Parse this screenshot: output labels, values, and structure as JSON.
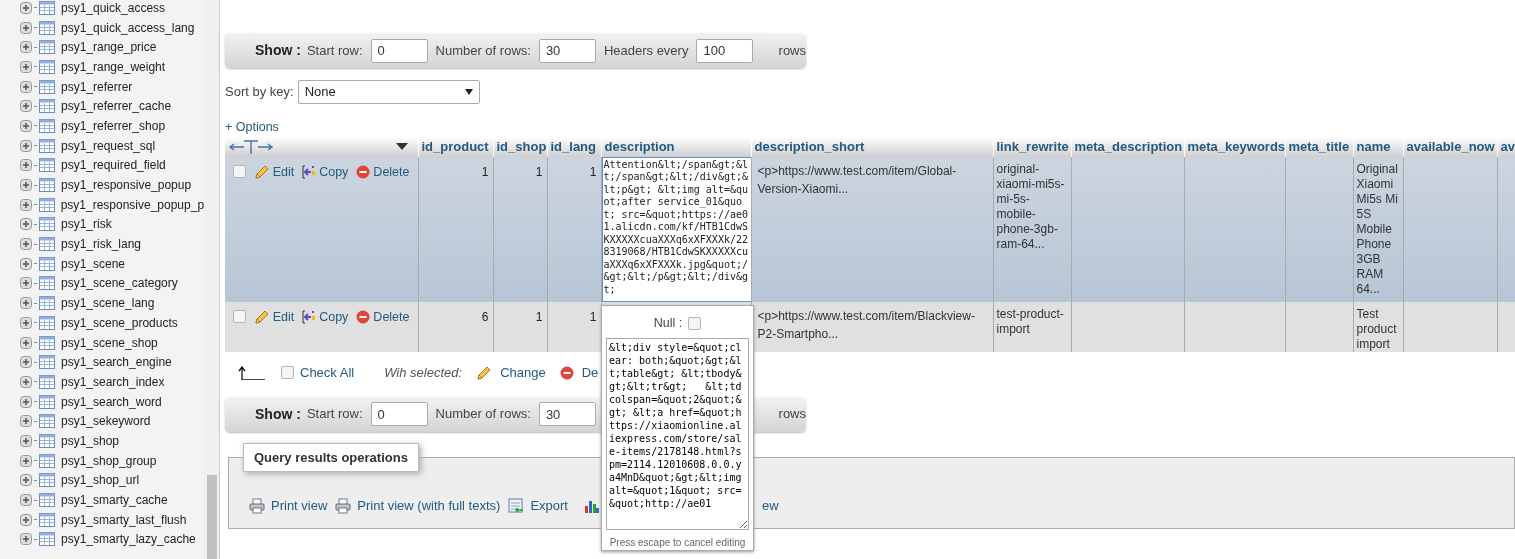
{
  "sidebar": {
    "items": [
      {
        "label": "psy1_quick_access"
      },
      {
        "label": "psy1_quick_access_lang"
      },
      {
        "label": "psy1_range_price"
      },
      {
        "label": "psy1_range_weight"
      },
      {
        "label": "psy1_referrer"
      },
      {
        "label": "psy1_referrer_cache"
      },
      {
        "label": "psy1_referrer_shop"
      },
      {
        "label": "psy1_request_sql"
      },
      {
        "label": "psy1_required_field"
      },
      {
        "label": "psy1_responsive_popup"
      },
      {
        "label": "psy1_responsive_popup_p"
      },
      {
        "label": "psy1_risk"
      },
      {
        "label": "psy1_risk_lang"
      },
      {
        "label": "psy1_scene"
      },
      {
        "label": "psy1_scene_category"
      },
      {
        "label": "psy1_scene_lang"
      },
      {
        "label": "psy1_scene_products"
      },
      {
        "label": "psy1_scene_shop"
      },
      {
        "label": "psy1_search_engine"
      },
      {
        "label": "psy1_search_index"
      },
      {
        "label": "psy1_search_word"
      },
      {
        "label": "psy1_sekeyword"
      },
      {
        "label": "psy1_shop"
      },
      {
        "label": "psy1_shop_group"
      },
      {
        "label": "psy1_shop_url"
      },
      {
        "label": "psy1_smarty_cache"
      },
      {
        "label": "psy1_smarty_last_flush"
      },
      {
        "label": "psy1_smarty_lazy_cache"
      }
    ]
  },
  "show_bars": [
    {
      "title": "Show :",
      "fields": [
        {
          "label": "Start row:",
          "value": "0"
        },
        {
          "label": "Number of rows:",
          "value": "30"
        },
        {
          "label": "Headers every",
          "value": "100"
        }
      ],
      "suffix": "rows"
    },
    {
      "title": "Show :",
      "fields": [
        {
          "label": "Start row:",
          "value": "0"
        },
        {
          "label": "Number of rows:",
          "value": "30"
        }
      ],
      "suffix": "rows"
    }
  ],
  "sort": {
    "label": "Sort by key:",
    "value": "None"
  },
  "options_link": "+ Options",
  "table": {
    "columns": [
      "id_product",
      "id_shop",
      "id_lang",
      "description",
      "description_short",
      "link_rewrite",
      "meta_description",
      "meta_keywords",
      "meta_title",
      "name",
      "available_now",
      "av"
    ],
    "rows": [
      {
        "hovered": true,
        "checked": false,
        "actions": [
          "Edit",
          "Copy",
          "Delete"
        ],
        "id_product": "1",
        "id_shop": "1",
        "id_lang": "1",
        "description": "Attention&lt;/span&gt;&lt;/span&gt;&lt;/div&gt;&lt;p&gt; &lt;img alt=&quot;after service_01&quot; src=&quot;https://ae01.alicdn.com/kf/HTB1CdwSKXXXXXcuaXXXq6xXFXXXk/228319068/HTB1CdwSKXXXXXcuaXXXq6xXFXXXk.jpg&quot;/&gt;&lt;/p&gt;&lt;/div&gt;",
        "description_short": "<p>https://www.test.com/item/Global-Version-Xiaomi...",
        "link_rewrite": "original-xiaomi-mi5s-mi-5s-mobile-phone-3gb-ram-64...",
        "name": "Original Xiaomi Mi5s Mi 5S Mobile Phone 3GB RAM 64..."
      },
      {
        "hovered": false,
        "checked": false,
        "actions": [
          "Edit",
          "Copy",
          "Delete"
        ],
        "id_product": "6",
        "id_shop": "1",
        "id_lang": "1",
        "description_short": "<p>https://www.test.com/item/Blackview-P2-Smartpho...",
        "link_rewrite": "test-product-import",
        "name": "Test product import"
      }
    ]
  },
  "editor_popup": {
    "null_label": "Null :",
    "null_checked": false,
    "value": "&lt;div style=&quot;clear: both;&quot;&gt;&lt;table&gt; &lt;tbody&gt;&lt;tr&gt;   &lt;td colspan=&quot;2&quot;&gt; &lt;a href=&quot;https://xiaomionline.aliexpress.com/store/sale-items/2178148.html?spm=2114.12010608.0.0.ya4MnD&quot;&gt;&lt;img alt=&quot;1&quot; src=&quot;http://ae01",
    "hint": "Press escape to cancel editing"
  },
  "bulk": {
    "check_all": "Check All",
    "check_all_checked": false,
    "with_selected": "Wih selected:",
    "actions": [
      {
        "kind": "change",
        "label": "Change"
      },
      {
        "kind": "delete",
        "label": "De"
      }
    ]
  },
  "query_operations": {
    "legend": "Query results operations",
    "links": [
      {
        "kind": "print",
        "label": "Print view"
      },
      {
        "kind": "print",
        "label": "Print view (with full texts)"
      },
      {
        "kind": "export",
        "label": "Export"
      },
      {
        "kind": "chart"
      },
      {
        "kind": "view",
        "label": "ew"
      }
    ]
  }
}
